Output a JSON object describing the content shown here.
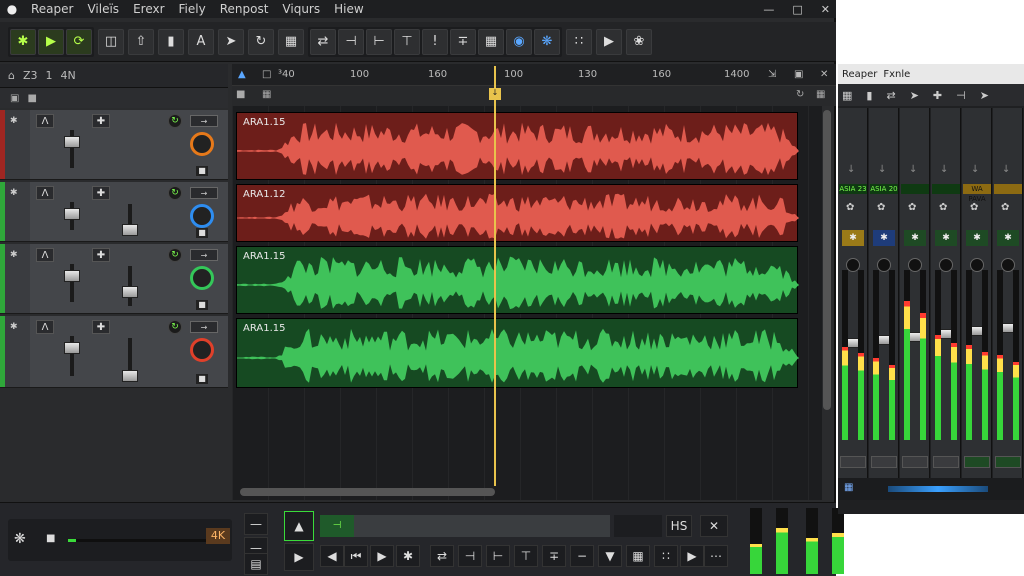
{
  "app": {
    "title": "Reaper"
  },
  "menubar": {
    "items": [
      "Reaper",
      "Vileïs",
      "Erexr",
      "Fiely",
      "Renpost",
      "Viqurs",
      "Hiew"
    ],
    "window_controls": [
      "—",
      "□",
      "✕"
    ]
  },
  "toolbar": {
    "buttons": [
      "gear-icon",
      "play-icon",
      "loop-icon",
      "grid-icon",
      "upload-icon",
      "columns-icon",
      "text-icon",
      "cursor-icon",
      "refresh-icon",
      "lock-icon",
      "split-icon",
      "trim-icon",
      "ripple-icon",
      "marker-icon",
      "stretch-icon",
      "record-icon",
      "circle-icon",
      "settings-icon",
      "snap-icon",
      "play-alt-icon",
      "fx-icon"
    ]
  },
  "tcp_header": {
    "label1": "Z3",
    "label2": "1",
    "label3": "4N"
  },
  "ruler": {
    "ticks": [
      {
        "label": "³40"
      },
      {
        "label": "100"
      },
      {
        "label": "160"
      },
      {
        "label": "100"
      },
      {
        "label": "130"
      },
      {
        "label": "160"
      },
      {
        "label": "1400"
      }
    ],
    "playhead_marker": "↓"
  },
  "tracks": [
    {
      "name": "ARA1.15",
      "color": "#b8302a",
      "wave": "#e05a4e",
      "item_bg": "#6d1e1a",
      "knob": "#e6791a",
      "stripe": "#a02622"
    },
    {
      "name": "ARA1.12",
      "color": "#b8302a",
      "wave": "#e05a4e",
      "item_bg": "#6d1e1a",
      "knob": "#2e8df0",
      "stripe": "#2fa83a"
    },
    {
      "name": "ARA1.15",
      "color": "#2a8a3a",
      "wave": "#3fc25a",
      "item_bg": "#164a22",
      "knob": "#34c759",
      "stripe": "#2fa83a"
    },
    {
      "name": "ARA1.15",
      "color": "#2a8a3a",
      "wave": "#3fc25a",
      "item_bg": "#164a22",
      "knob": "#e0402a",
      "stripe": "#2fa83a"
    }
  ],
  "transport": {
    "zoom_label": "4K",
    "rec_label": "HS",
    "close_label": "✕",
    "master_volume": 0.06
  },
  "mixer": {
    "title": "Reaper",
    "subtitle": "Fxnle",
    "strips": [
      {
        "name": "ASIA 23",
        "gold": false,
        "meter": 0.55
      },
      {
        "name": "ASIA 20",
        "gold": false,
        "meter": 0.48
      },
      {
        "name": "",
        "gold": false,
        "meter": 0.82
      },
      {
        "name": "",
        "gold": false,
        "meter": 0.62
      },
      {
        "name": "WA PAVA",
        "gold": true,
        "meter": 0.56
      },
      {
        "name": "",
        "gold": true,
        "meter": 0.5
      }
    ]
  },
  "bottom_meters": [
    0.45,
    0.7,
    0.55,
    0.62
  ]
}
